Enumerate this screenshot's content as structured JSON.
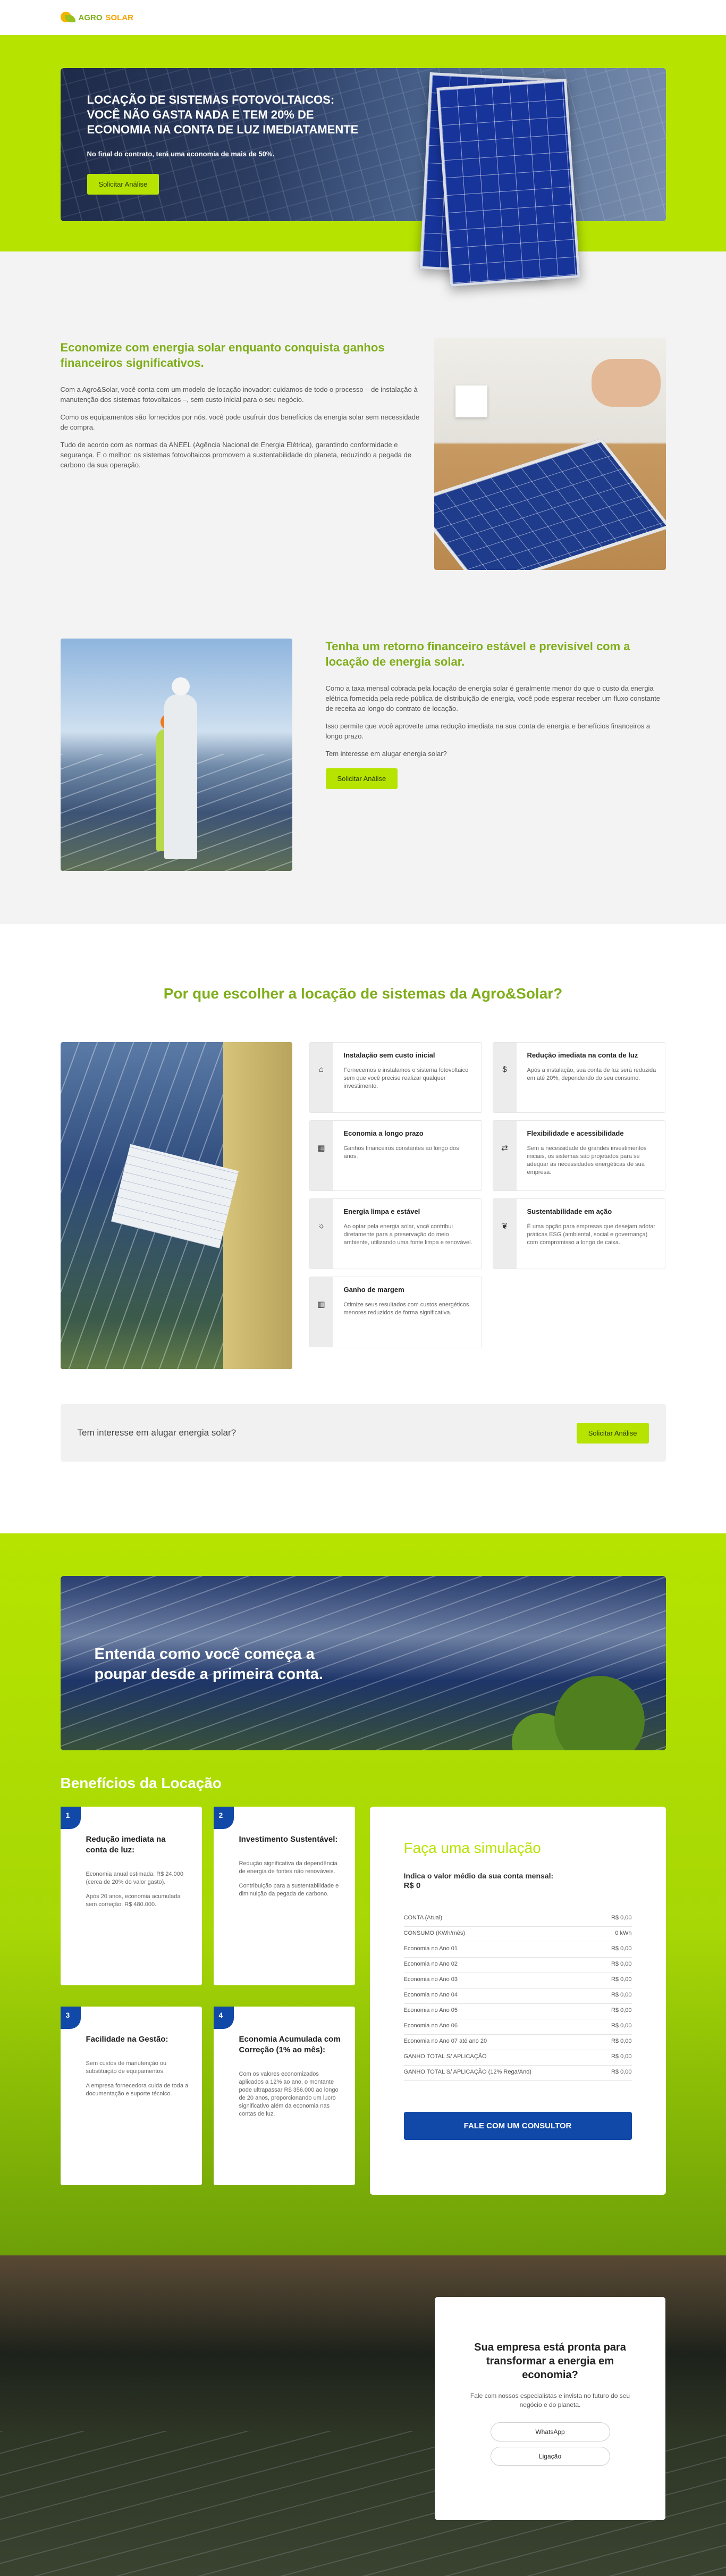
{
  "header": {
    "logo_agro": "AGRO",
    "logo_solar": "SOLAR"
  },
  "hero": {
    "title": "LOCAÇÃO DE SISTEMAS FOTOVOLTAICOS: VOCÊ NÃO GASTA NADA E TEM 20% DE ECONOMIA NA CONTA DE LUZ IMEDIATAMENTE",
    "subtitle": "No final do contrato, terá uma economia de mais de 50%.",
    "button": "Solicitar Análise"
  },
  "economy": {
    "title": "Economize com energia solar enquanto conquista ganhos financeiros significativos.",
    "p1": "Com a Agro&Solar, você conta com um modelo de locação inovador: cuidamos de todo o processo – de instalação à manutenção dos sistemas fotovoltaicos –, sem custo inicial para o seu negócio.",
    "p2": "Como os equipamentos são fornecidos por nós, você pode usufruir dos benefícios da energia solar sem necessidade de compra.",
    "p3": "Tudo de acordo com as normas da ANEEL (Agência Nacional de Energia Elétrica), garantindo conformidade e segurança. E o melhor: os sistemas fotovoltaicos promovem a sustentabilidade do planeta, reduzindo a pegada de carbono da sua operação."
  },
  "return": {
    "title": "Tenha um retorno financeiro estável e previsível com a locação de energia solar.",
    "p1": "Como a taxa mensal cobrada pela locação de energia solar é geralmente menor do que o custo da energia elétrica fornecida pela rede pública de distribuição de energia, você pode esperar receber um fluxo constante de receita ao longo do contrato de locação.",
    "p2": "Isso permite que você aproveite uma redução imediata na sua conta de energia e benefícios financeiros a longo prazo.",
    "p3": "Tem interesse em alugar energia solar?",
    "button": "Solicitar Análise"
  },
  "why": {
    "title": "Por que escolher a locação de sistemas da Agro&Solar?",
    "features": [
      {
        "icon": "home-icon",
        "glyph": "⌂",
        "title": "Instalação sem custo inicial",
        "text": "Fornecemos e instalamos o sistema fotovoltaico sem que você precise realizar qualquer investimento."
      },
      {
        "icon": "dollar-icon",
        "glyph": "$",
        "title": "Redução imediata na conta de luz",
        "text": "Após a instalação, sua conta de luz será reduzida em até 20%, dependendo do seu consumo."
      },
      {
        "icon": "calendar-icon",
        "glyph": "▦",
        "title": "Economia a longo prazo",
        "text": "Ganhos financeiros constantes ao longo dos anos."
      },
      {
        "icon": "flexibility-icon",
        "glyph": "⇄",
        "title": "Flexibilidade e acessibilidade",
        "text": "Sem a necessidade de grandes investimentos iniciais, os sistemas são projetados para se adequar às necessidades energéticas de sua empresa."
      },
      {
        "icon": "sun-icon",
        "glyph": "☼",
        "title": "Energia limpa e estável",
        "text": "Ao optar pela energia solar, você contribui diretamente para a preservação do meio ambiente, utilizando uma fonte limpa e renovável."
      },
      {
        "icon": "leaf-icon",
        "glyph": "❦",
        "title": "Sustentabilidade em ação",
        "text": "É uma opção para empresas que desejam adotar práticas ESG (ambiental, social e governança) com compromisso a longo de caixa."
      },
      {
        "icon": "chart-icon",
        "glyph": "▥",
        "title": "Ganho de margem",
        "text": "Otimize seus resultados com custos energéticos menores reduzidos de forma significativa."
      }
    ],
    "interest_text": "Tem interesse em alugar energia solar?",
    "interest_button": "Solicitar Análise"
  },
  "banner": {
    "title": "Entenda como você começa a poupar desde a primeira conta."
  },
  "benefits": {
    "title": "Benefícios da Locação",
    "cards": [
      {
        "num": "1",
        "title": "Redução imediata na conta de luz:",
        "p1": "Economia anual estimada: R$ 24.000 (cerca de 20% do valor gasto).",
        "p2": "Após 20 anos, economia acumulada sem correção: R$ 480.000."
      },
      {
        "num": "2",
        "title": "Investimento Sustentável:",
        "p1": "Redução significativa da dependência de energia de fontes não renováveis.",
        "p2": "Contribuição para a sustentabilidade e diminuição da pegada de carbono."
      },
      {
        "num": "3",
        "title": "Facilidade na Gestão:",
        "p1": "Sem custos de manutenção ou substituição de equipamentos.",
        "p2": "A empresa fornecedora cuida de toda a documentação e suporte técnico."
      },
      {
        "num": "4",
        "title": "Economia Acumulada com Correção (1% ao mês):",
        "p1": "Com os valores economizados aplicados a 12% ao ano, o montante pode ultrapassar R$ 356.000 ao longo de 20 anos, proporcionando um lucro significativo além da economia nas contas de luz.",
        "p2": ""
      }
    ]
  },
  "simulation": {
    "title": "Faça uma simulação",
    "label": "Indica o valor médio da sua conta mensal:",
    "amount": "R$ 0",
    "rows": [
      {
        "label": "CONTA (Atual)",
        "value": "R$ 0,00"
      },
      {
        "label": "CONSUMO (KWh/mês)",
        "value": "0 kWh"
      },
      {
        "label": "Economia no Ano 01",
        "value": "R$ 0,00"
      },
      {
        "label": "Economia no Ano 02",
        "value": "R$ 0,00"
      },
      {
        "label": "Economia no Ano 03",
        "value": "R$ 0,00"
      },
      {
        "label": "Economia no Ano 04",
        "value": "R$ 0,00"
      },
      {
        "label": "Economia no Ano 05",
        "value": "R$ 0,00"
      },
      {
        "label": "Economia no Ano 06",
        "value": "R$ 0,00"
      },
      {
        "label": "Economia no Ano 07 até ano 20",
        "value": "R$ 0,00"
      },
      {
        "label": "GANHO TOTAL S/ APLICAÇÃO",
        "value": "R$ 0,00"
      },
      {
        "label": "GANHO TOTAL S/ APLICAÇÃO (12% Rega/Ano)",
        "value": "R$ 0,00"
      }
    ],
    "button": "FALE COM UM CONSULTOR"
  },
  "cta": {
    "title": "Sua empresa está pronta para transformar a energia em economia?",
    "text": "Fale com nossos especialistas e invista no futuro do seu negócio e do planeta.",
    "whatsapp": "WhatsApp",
    "call": "Ligação"
  }
}
